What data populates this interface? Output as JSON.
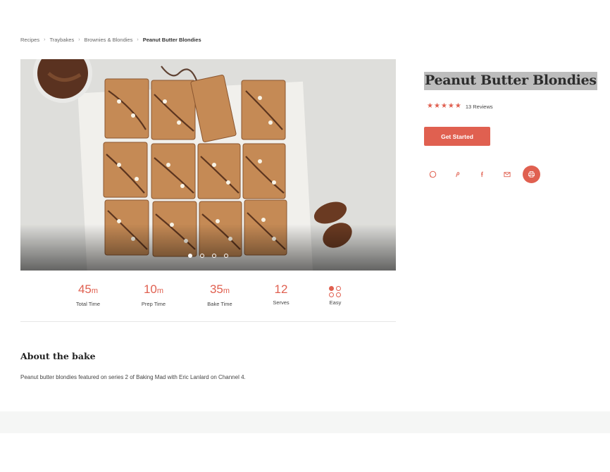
{
  "breadcrumb": {
    "items": [
      "Recipes",
      "Traybakes",
      "Brownies & Blondies"
    ],
    "current": "Peanut Butter Blondies",
    "separator": "›"
  },
  "recipe": {
    "title": "Peanut Butter Blondies",
    "rating": {
      "stars": 5,
      "reviews_label": "13 Reviews"
    },
    "cta_label": "Get Started"
  },
  "share": {
    "icons": [
      "whatsapp-icon",
      "pinterest-icon",
      "facebook-icon",
      "email-icon",
      "print-icon"
    ]
  },
  "carousel": {
    "slide_count": 4,
    "active_index": 0
  },
  "stats": [
    {
      "value": "45",
      "unit": "m",
      "label": "Total Time"
    },
    {
      "value": "10",
      "unit": "m",
      "label": "Prep Time"
    },
    {
      "value": "35",
      "unit": "m",
      "label": "Bake Time"
    },
    {
      "value": "12",
      "unit": "",
      "label": "Serves"
    },
    {
      "value": "",
      "unit": "",
      "label": "Easy"
    }
  ],
  "about": {
    "heading": "About the bake",
    "text": "Peanut butter blondies featured on series 2 of Baking Mad with Eric Lanlard on Channel 4."
  },
  "colors": {
    "accent": "#e06050",
    "title_highlight": "#bdbdbd",
    "footer_band": "#f5f6f5"
  }
}
